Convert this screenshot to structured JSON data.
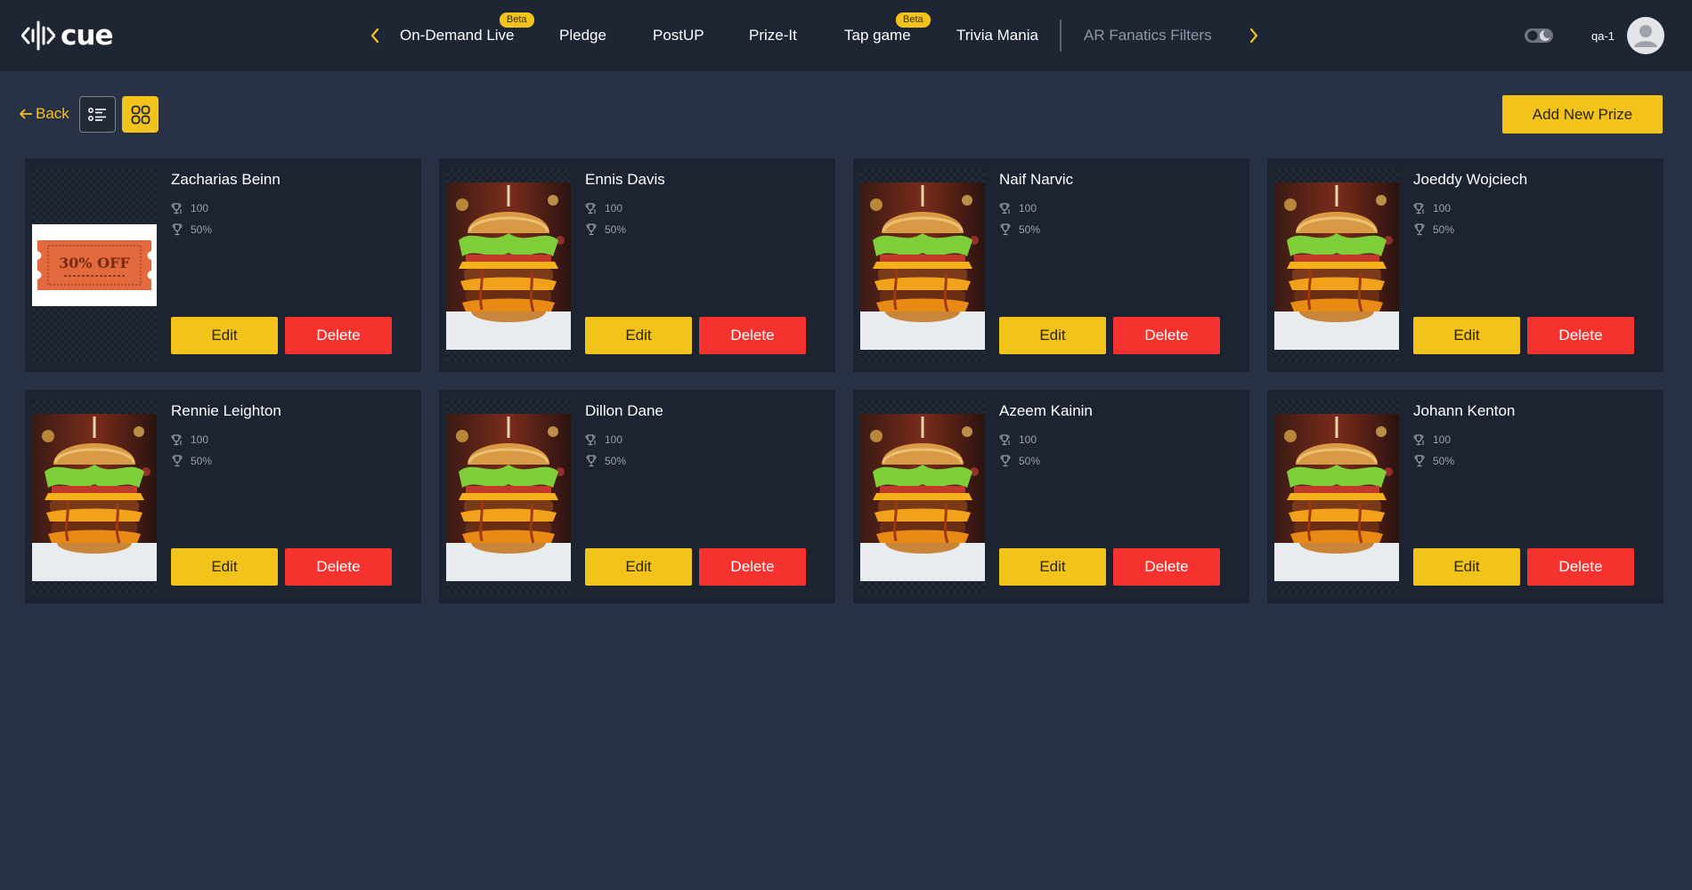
{
  "app": {
    "logo_text": "cue"
  },
  "nav": {
    "items": [
      {
        "label": "On-Demand Live",
        "badge": "Beta"
      },
      {
        "label": "Pledge"
      },
      {
        "label": "PostUP"
      },
      {
        "label": "Prize-It"
      },
      {
        "label": "Tap game",
        "badge": "Beta"
      },
      {
        "label": "Trivia Mania"
      },
      {
        "label": "AR Fanatics Filters"
      }
    ],
    "prev_icon": "chevron-left-icon",
    "next_icon": "chevron-right-icon"
  },
  "user": {
    "name": "qa-1",
    "avatar_icon": "user-icon",
    "theme_icon": "theme-toggle-icon"
  },
  "toolbar": {
    "back_label": "Back",
    "list_view_icon": "list-view-icon",
    "grid_view_icon": "grid-view-icon",
    "active_view": "grid",
    "add_label": "Add New Prize"
  },
  "prizes": [
    {
      "name": "Zacharias Beinn",
      "quantity": "100",
      "percent": "50%",
      "image": "coupon",
      "coupon_text": "30% OFF"
    },
    {
      "name": "Ennis Davis",
      "quantity": "100",
      "percent": "50%",
      "image": "burger"
    },
    {
      "name": "Naif Narvic",
      "quantity": "100",
      "percent": "50%",
      "image": "burger"
    },
    {
      "name": "Joeddy Wojciech",
      "quantity": "100",
      "percent": "50%",
      "image": "burger"
    },
    {
      "name": "Rennie Leighton",
      "quantity": "100",
      "percent": "50%",
      "image": "burger"
    },
    {
      "name": "Dillon Dane",
      "quantity": "100",
      "percent": "50%",
      "image": "burger"
    },
    {
      "name": "Azeem Kainin",
      "quantity": "100",
      "percent": "50%",
      "image": "burger"
    },
    {
      "name": "Johann Kenton",
      "quantity": "100",
      "percent": "50%",
      "image": "burger"
    }
  ],
  "card_actions": {
    "edit_label": "Edit",
    "delete_label": "Delete"
  },
  "colors": {
    "accent": "#f2c31b",
    "danger": "#f6322f",
    "background": "#283244",
    "card": "#1c2331"
  }
}
